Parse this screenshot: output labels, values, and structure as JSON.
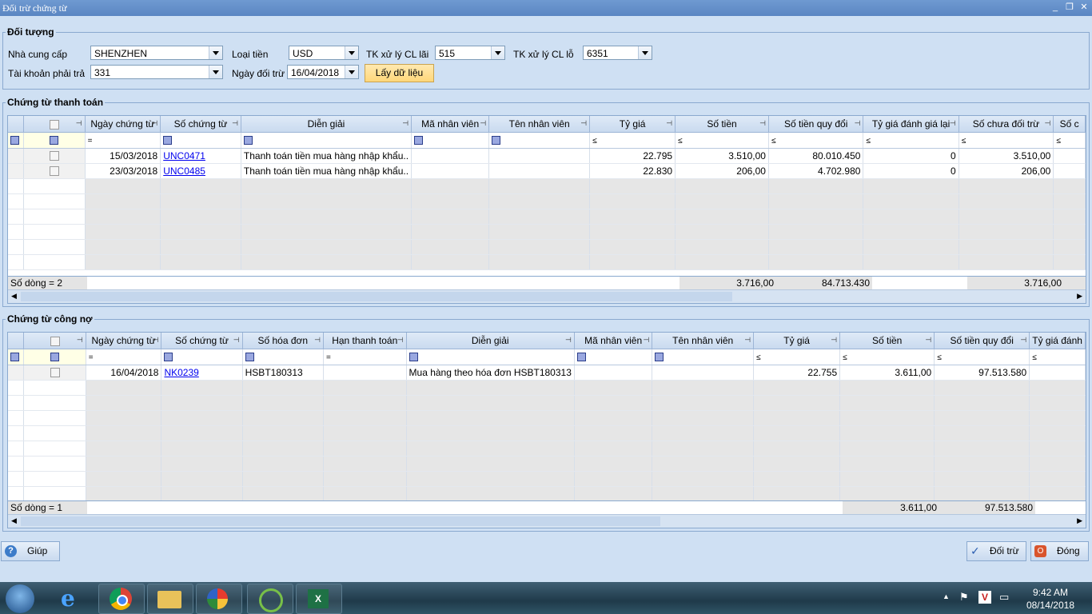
{
  "window": {
    "title": "Đối trừ chứng từ",
    "controls": [
      "_",
      "❐",
      "✕"
    ]
  },
  "doi_tuong": {
    "group_title": "Đối tượng",
    "nha_cung_cap_label": "Nhà cung cấp",
    "nha_cung_cap_value": "SHENZHEN",
    "tai_khoan_label": "Tài khoản phải trả",
    "tai_khoan_value": "331",
    "loai_tien_label": "Loại tiền",
    "loai_tien_value": "USD",
    "ngay_doi_tru_label": "Ngày đối trừ",
    "ngay_doi_tru_value": "16/04/2018",
    "tk_lai_label": "TK xử lý CL lãi",
    "tk_lai_value": "515",
    "tk_lo_label": "TK xử lý CL lỗ",
    "tk_lo_value": "6351",
    "load_button": "Lấy dữ liệu"
  },
  "thanh_toan": {
    "group_title": "Chứng từ thanh toán",
    "headers": [
      "Ngày chứng từ",
      "Số chứng từ",
      "Diễn giải",
      "Mã nhân viên",
      "Tên nhân viên",
      "Tỷ giá",
      "Số tiền",
      "Số tiền quy đổi",
      "Tỷ giá đánh giá lại",
      "Số chưa đối trừ",
      "Số c"
    ],
    "filters": [
      "=",
      "",
      "",
      "",
      "",
      "≤",
      "≤",
      "≤",
      "≤",
      "≤",
      "≤"
    ],
    "rows": [
      {
        "ngay": "15/03/2018",
        "so_ct": "UNC0471",
        "dien_giai": "Thanh toán tiền mua hàng nhập khẩu..",
        "ty_gia": "22.795",
        "so_tien": "3.510,00",
        "quy_doi": "80.010.450",
        "danh_gia_lai": "0",
        "chua_doi_tru": "3.510,00"
      },
      {
        "ngay": "23/03/2018",
        "so_ct": "UNC0485",
        "dien_giai": "Thanh toán tiền mua hàng nhập khẩu..",
        "ty_gia": "22.830",
        "so_tien": "206,00",
        "quy_doi": "4.702.980",
        "danh_gia_lai": "0",
        "chua_doi_tru": "206,00"
      }
    ],
    "footer": {
      "count": "Số dòng = 2",
      "so_tien": "3.716,00",
      "quy_doi": "84.713.430",
      "chua_doi_tru": "3.716,00"
    }
  },
  "cong_no": {
    "group_title": "Chứng từ công nợ",
    "headers": [
      "Ngày chứng từ",
      "Số chứng từ",
      "Số hóa đơn",
      "Hạn thanh toán",
      "Diễn giải",
      "Mã nhân viên",
      "Tên nhân viên",
      "Tỷ giá",
      "Số tiền",
      "Số tiền quy đổi",
      "Tỷ giá đánh"
    ],
    "filters": [
      "=",
      "",
      "",
      "=",
      "",
      "",
      "",
      "≤",
      "≤",
      "≤",
      "≤"
    ],
    "rows": [
      {
        "ngay": "16/04/2018",
        "so_ct": "NK0239",
        "so_hd": "HSBT180313",
        "han_tt": "",
        "dien_giai": "Mua hàng theo hóa đơn HSBT180313",
        "ty_gia": "22.755",
        "so_tien": "3.611,00",
        "quy_doi": "97.513.580"
      }
    ],
    "footer": {
      "count": "Số dòng = 1",
      "so_tien": "3.611,00",
      "quy_doi": "97.513.580"
    }
  },
  "buttons": {
    "help": "Giúp",
    "doi_tru": "Đối trừ",
    "dong": "Đóng"
  },
  "taskbar": {
    "time": "9:42 AM",
    "date": "08/14/2018"
  },
  "colors": {
    "header": "#c9daef",
    "accent": "#ffd77a",
    "link": "#0000ee"
  }
}
